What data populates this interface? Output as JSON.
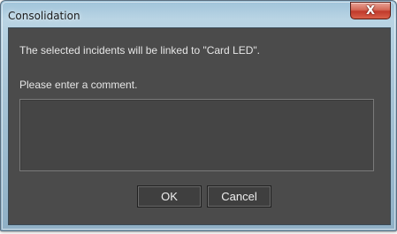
{
  "window": {
    "title": "Consolidation",
    "close_glyph": "X"
  },
  "dialog": {
    "message": "The selected incidents will be linked to \"Card LED\".",
    "prompt": "Please enter a comment.",
    "comment_value": "",
    "ok_label": "OK",
    "cancel_label": "Cancel"
  },
  "colors": {
    "client_background": "#4b4b4b",
    "text": "#e6e6e6",
    "close_button": "#c0392b",
    "titlebar": "#a7c4d6"
  },
  "icons": {
    "close": "close-icon"
  }
}
